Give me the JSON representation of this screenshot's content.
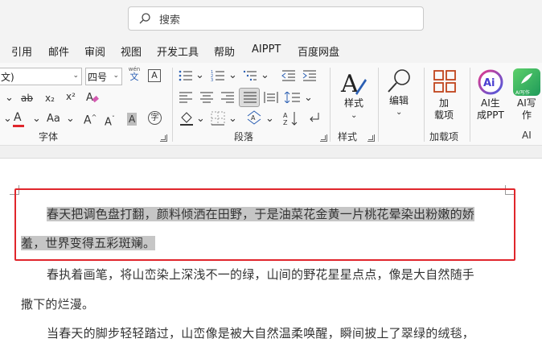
{
  "search": {
    "placeholder": "搜索"
  },
  "menu": [
    "引用",
    "邮件",
    "审阅",
    "视图",
    "开发工具",
    "帮助",
    "AIPPT",
    "百度网盘"
  ],
  "ribbon": {
    "font": {
      "font_name_value": "文)",
      "font_size_value": "四号",
      "wen_label": "wén",
      "wen_char": "文",
      "a_box": "A",
      "strike": "ab",
      "sub": "x₂",
      "sup": "x²",
      "font_color_glyph": "A",
      "case": "Aa",
      "grow": "A",
      "shrink": "A",
      "shade": "A",
      "enclose": "字",
      "label": "字体"
    },
    "paragraph": {
      "label": "段落"
    },
    "style": {
      "label": "样式",
      "group_label": "样式"
    },
    "edit": {
      "label": "编辑"
    },
    "addin": {
      "label_line1": "加",
      "label_line2": "载项",
      "group_label": "加载项"
    },
    "ai": {
      "aigen_line1": "AI生",
      "aigen_line2": "成PPT",
      "aiwrite_line1": "AI写",
      "aiwrite_line2": "作",
      "aiwrite_badge": "AI写作",
      "group_label": "AI"
    }
  },
  "document": {
    "line1": "春天把调色盘打翻，颜料倾洒在田野，于是油菜花金黄一片桃花晕染出粉嫩的娇",
    "line2": "羞，世界变得五彩斑斓。",
    "line3": "春执着画笔，将山峦染上深浅不一的绿，山间的野花星星点点，像是大自然随手",
    "line4": "撒下的烂漫。",
    "line5": "当春天的脚步轻轻踏过，山峦像是被大自然温柔唤醒，瞬间披上了翠绿的绒毯，"
  },
  "colors": {
    "selection_border": "#e0262c",
    "highlight": "#c6c6c6",
    "font_color_bar": "#e0262c",
    "accent_orange": "#c0441c"
  }
}
